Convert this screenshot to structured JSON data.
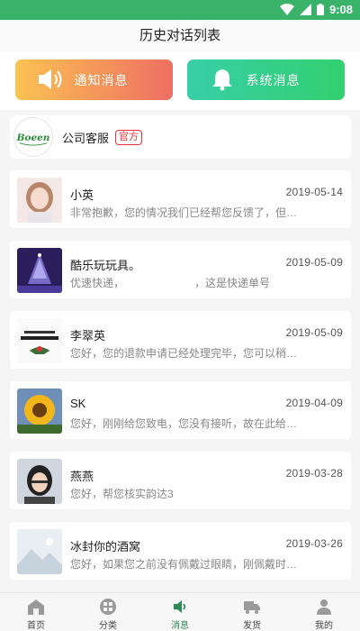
{
  "status_bar": {
    "time": "9:08",
    "icons": [
      "wifi-icon",
      "signal-icon",
      "battery-icon"
    ]
  },
  "header": {
    "title": "历史对话列表"
  },
  "top_buttons": [
    {
      "label": "通知消息",
      "icon": "speaker-icon",
      "colors": [
        "#fbc251",
        "#ef6f63"
      ]
    },
    {
      "label": "系统消息",
      "icon": "bell-icon",
      "colors": [
        "#38cfa7",
        "#33cf6f"
      ]
    }
  ],
  "service": {
    "logo_text": "Boeen",
    "name": "公司客服",
    "badge": "官方"
  },
  "conversations": [
    {
      "name": "小英",
      "date": "2019-05-14",
      "preview": "非常抱歉，您的情况我们已经帮您反馈了，但…"
    },
    {
      "name": "酷乐玩玩具。",
      "date": "2019-05-09",
      "preview": "优速快递，　　　　　　　，这是快递单号"
    },
    {
      "name": "李翠英",
      "date": "2019-05-09",
      "preview": "您好，您的退款申请已经处理完毕，您可以稍…"
    },
    {
      "name": "SK",
      "date": "2019-04-09",
      "preview": "您好，刚刚给您致电，您没有接听，故在此给…"
    },
    {
      "name": "燕燕",
      "date": "2019-03-28",
      "preview": "您好，帮您核实韵达3"
    },
    {
      "name": "冰封你的酒窝",
      "date": "2019-03-26",
      "preview": "您好，如果您之前没有佩戴过眼睛，刚佩戴时…"
    }
  ],
  "tabs": [
    {
      "label": "首页",
      "icon": "home-icon",
      "active": false
    },
    {
      "label": "分类",
      "icon": "category-icon",
      "active": false
    },
    {
      "label": "消息",
      "icon": "message-icon",
      "active": true
    },
    {
      "label": "发货",
      "icon": "truck-icon",
      "active": false
    },
    {
      "label": "我的",
      "icon": "user-icon",
      "active": false
    }
  ],
  "colors": {
    "status_bar": "#39b36a",
    "accent_green": "#2e8b57",
    "badge_red": "#e5333b"
  }
}
